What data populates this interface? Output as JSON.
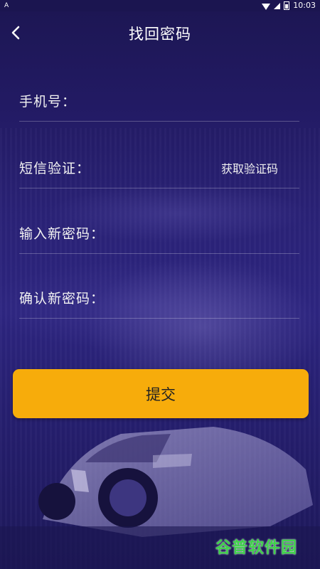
{
  "status_bar": {
    "app_badge": "A",
    "time": "10:03"
  },
  "header": {
    "title": "找回密码"
  },
  "form": {
    "phone_label": "手机号：",
    "sms_label": "短信验证：",
    "get_code_label": "获取验证码",
    "new_password_label": "输入新密码：",
    "confirm_password_label": "确认新密码："
  },
  "submit_label": "提交",
  "watermark": "谷普软件园",
  "colors": {
    "background": "#231b6a",
    "accent_button": "#f7ac0b",
    "watermark": "#3fd24a"
  },
  "icons": [
    "back-arrow-icon",
    "wifi-icon",
    "signal-icon",
    "battery-icon"
  ]
}
